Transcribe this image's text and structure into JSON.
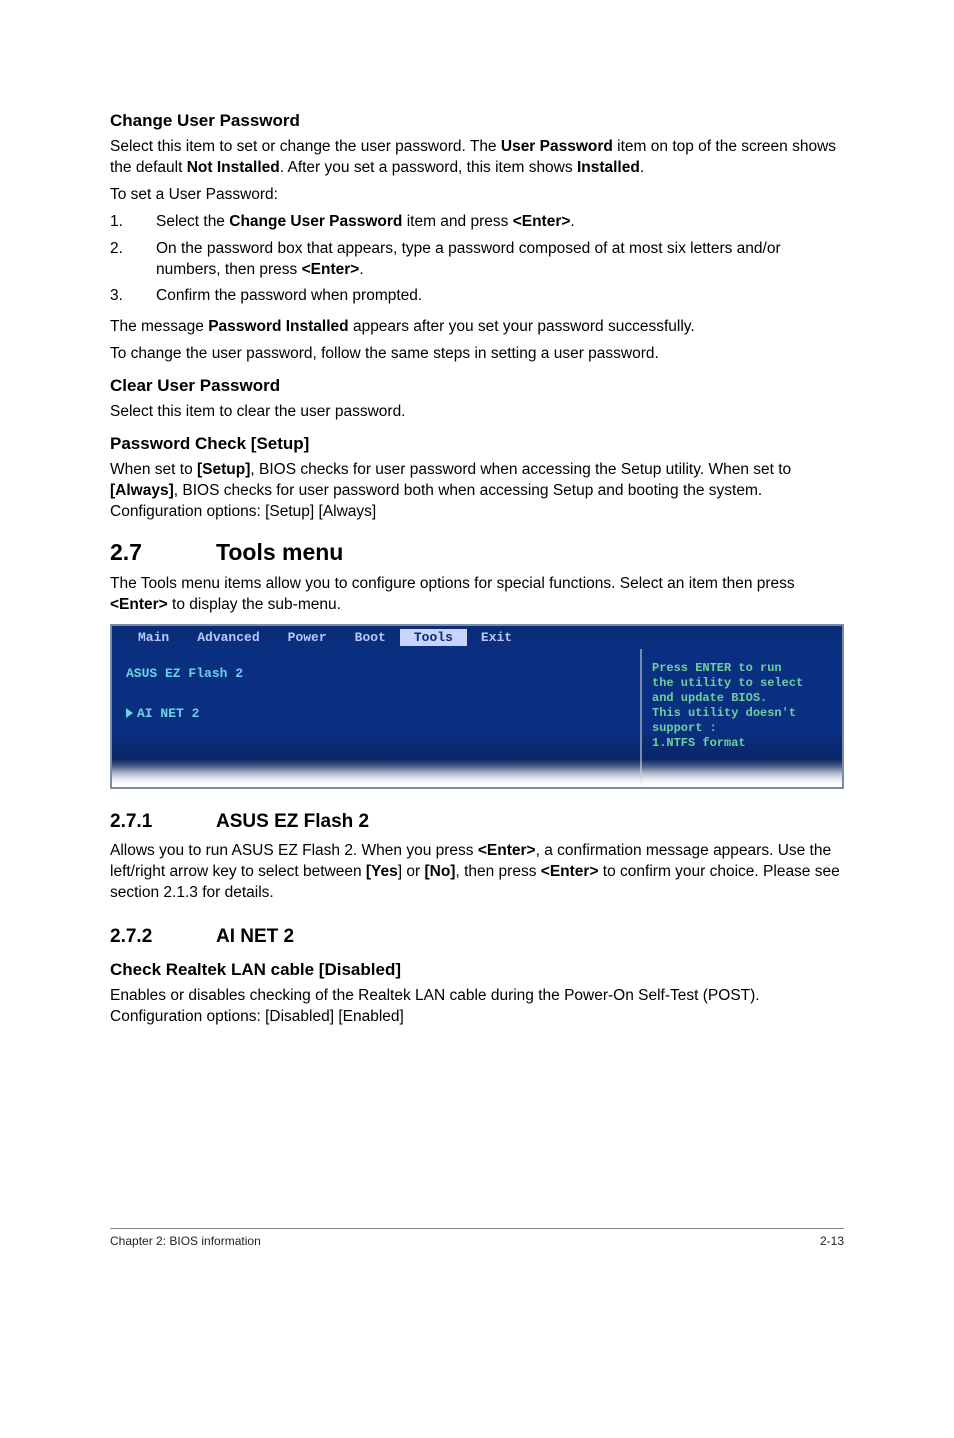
{
  "h_change_user_pw": "Change User Password",
  "p_change_user_pw_1a": "Select this item to set or change the user password. The ",
  "p_change_user_pw_1b": "User Password",
  "p_change_user_pw_1c": " item on top of the screen shows the default ",
  "p_change_user_pw_1d": "Not Installed",
  "p_change_user_pw_1e": ". After you set a password, this item shows ",
  "p_change_user_pw_1f": "Installed",
  "p_change_user_pw_1g": ".",
  "p_toset": "To set a User Password:",
  "steps": [
    {
      "n": "1.",
      "a": "Select the ",
      "b": "Change User Password",
      "c": " item and press ",
      "d": "<Enter>",
      "e": "."
    },
    {
      "n": "2.",
      "a": "On the password box that appears, type a password composed of at most six letters and/or numbers, then press ",
      "b": "",
      "c": "",
      "d": "<Enter>",
      "e": "."
    },
    {
      "n": "3.",
      "a": "Confirm the password when prompted.",
      "b": "",
      "c": "",
      "d": "",
      "e": ""
    }
  ],
  "p_msg_a": "The message ",
  "p_msg_b": "Password Installed",
  "p_msg_c": " appears after you set your password successfully.",
  "p_change": "To change the user password, follow the same steps in setting a user password.",
  "h_clear": "Clear User Password",
  "p_clear": "Select this item to clear the user password.",
  "h_pwcheck": "Password Check [Setup]",
  "p_pwcheck_a": "When set to ",
  "p_pwcheck_b": "[Setup]",
  "p_pwcheck_c": ", BIOS checks for user password when accessing the Setup utility. When set to ",
  "p_pwcheck_d": "[Always]",
  "p_pwcheck_e": ", BIOS checks for user password both when accessing Setup and booting the system. Configuration options: [Setup] [Always]",
  "sec27_num": "2.7",
  "sec27_title": "Tools menu",
  "p_tools_a": "The Tools menu items allow you to configure options for special functions. Select an item then press ",
  "p_tools_b": "<Enter>",
  "p_tools_c": " to display the sub-menu.",
  "bios": {
    "tabs": [
      "Main",
      "Advanced",
      "Power",
      "Boot",
      "Tools",
      "Exit"
    ],
    "active_tab": "Tools",
    "left_item1": "ASUS EZ Flash 2",
    "left_item2": "AI NET 2",
    "help": "Press ENTER to run\nthe utility to select\nand update BIOS.\nThis utility doesn't\nsupport :\n1.NTFS format"
  },
  "sec271_num": "2.7.1",
  "sec271_title": "ASUS EZ Flash 2",
  "p271_a": "Allows you to run ASUS EZ Flash 2. When you press ",
  "p271_b": "<Enter>",
  "p271_c": ", a confirmation message appears. Use the left/right arrow key to select between ",
  "p271_d": "[Yes",
  "p271_e": "] or ",
  "p271_f": "[No]",
  "p271_g": ", then press ",
  "p271_h": "<Enter>",
  "p271_i": " to confirm your choice. Please see section 2.1.3 for details.",
  "sec272_num": "2.7.2",
  "sec272_title": "AI NET 2",
  "h_realtek": "Check Realtek LAN cable [Disabled]",
  "p_realtek": "Enables or disables checking of the Realtek LAN cable during the Power-On Self-Test (POST). Configuration options: [Disabled] [Enabled]",
  "footer_left": "Chapter 2: BIOS information",
  "footer_right": "2-13"
}
